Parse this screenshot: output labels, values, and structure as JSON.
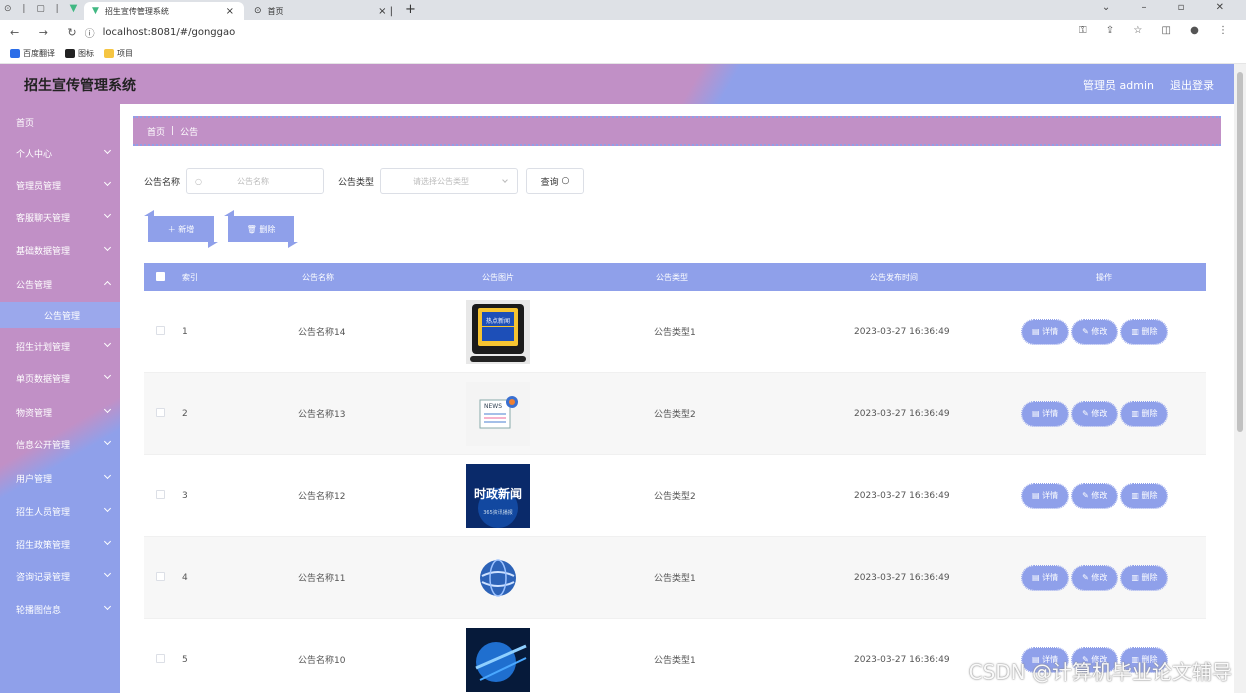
{
  "browser": {
    "tabs": [
      {
        "label": "招生宣传管理系统",
        "active": true
      },
      {
        "label": "首页",
        "active": false
      }
    ],
    "url": "localhost:8081/#/gonggao",
    "bookmarks": [
      "百度翻译",
      "图标",
      "项目"
    ]
  },
  "header": {
    "title": "招生宣传管理系统",
    "user": "管理员 admin",
    "logout": "退出登录",
    "colors": {
      "pink": "#c190c6",
      "blue": "#8fa0ea"
    }
  },
  "sidebar": {
    "items": [
      {
        "label": "首页",
        "has_arrow": false
      },
      {
        "label": "个人中心",
        "has_arrow": true
      },
      {
        "label": "管理员管理",
        "has_arrow": true
      },
      {
        "label": "客服聊天管理",
        "has_arrow": true
      },
      {
        "label": "基础数据管理",
        "has_arrow": true
      },
      {
        "label": "公告管理",
        "has_arrow": true,
        "expanded": true
      },
      {
        "label": "招生计划管理",
        "has_arrow": true
      },
      {
        "label": "单页数据管理",
        "has_arrow": true
      },
      {
        "label": "物资管理",
        "has_arrow": true
      },
      {
        "label": "信息公开管理",
        "has_arrow": true
      },
      {
        "label": "用户管理",
        "has_arrow": true
      },
      {
        "label": "招生人员管理",
        "has_arrow": true
      },
      {
        "label": "招生政策管理",
        "has_arrow": true
      },
      {
        "label": "咨询记录管理",
        "has_arrow": true
      },
      {
        "label": "轮播图信息",
        "has_arrow": true
      }
    ],
    "sub_item": "公告管理"
  },
  "breadcrumb": {
    "home": "首页",
    "current": "公告"
  },
  "search": {
    "name_label": "公告名称",
    "name_placeholder": "公告名称",
    "type_label": "公告类型",
    "type_placeholder": "请选择公告类型",
    "query_button": "查询"
  },
  "actions": {
    "add": "新增",
    "delete": "删除"
  },
  "table": {
    "headers": {
      "index": "索引",
      "name": "公告名称",
      "image": "公告图片",
      "type": "公告类型",
      "time": "公告发布时间",
      "ops": "操作"
    },
    "rows": [
      {
        "index": "1",
        "name": "公告名称14",
        "type": "公告类型1",
        "time": "2023-03-27 16:36:49",
        "image": "hot-news"
      },
      {
        "index": "2",
        "name": "公告名称13",
        "type": "公告类型2",
        "time": "2023-03-27 16:36:49",
        "image": "news-paper"
      },
      {
        "index": "3",
        "name": "公告名称12",
        "type": "公告类型2",
        "time": "2023-03-27 16:36:49",
        "image": "politics-news"
      },
      {
        "index": "4",
        "name": "公告名称11",
        "type": "公告类型1",
        "time": "2023-03-27 16:36:49",
        "image": "globe"
      },
      {
        "index": "5",
        "name": "公告名称10",
        "type": "公告类型1",
        "time": "2023-03-27 16:36:49",
        "image": "globe-blue"
      }
    ],
    "op_labels": {
      "detail": "详情",
      "edit": "修改",
      "delete": "删除"
    }
  },
  "thumb_text": {
    "hot": "热点新闻",
    "news": "NEWS",
    "politics": "时政新闻",
    "politics_sub": "365资讯播报"
  },
  "watermark": "CSDN @计算机毕业论文辅导"
}
